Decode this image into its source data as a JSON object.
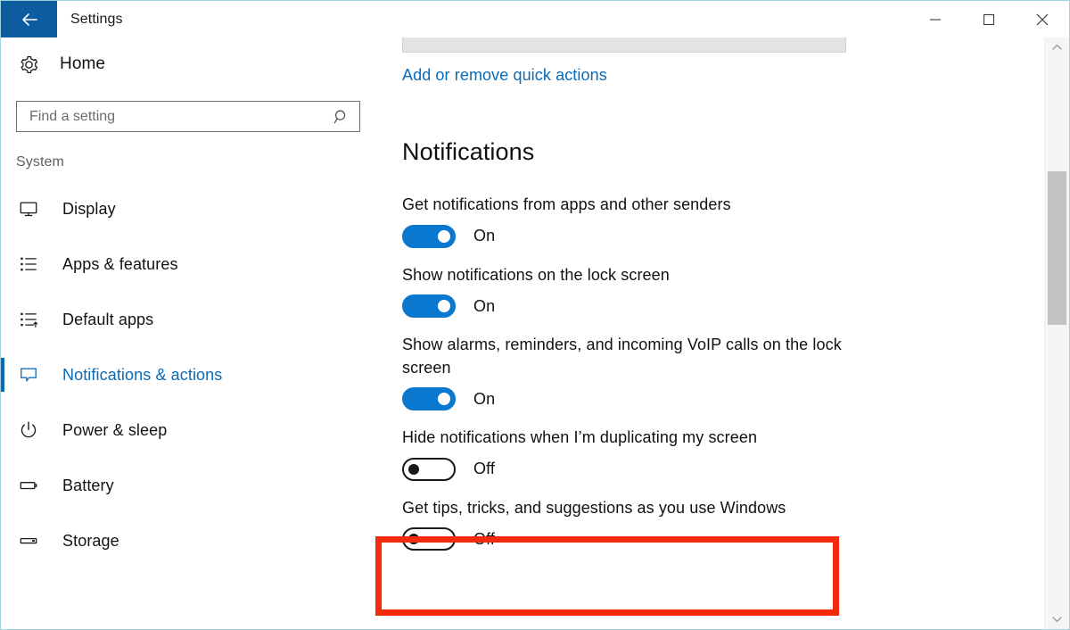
{
  "window": {
    "title": "Settings",
    "back_icon": "back-arrow-icon",
    "controls": [
      {
        "name": "minimize-button",
        "icon": "minimize-icon",
        "label": "Minimize"
      },
      {
        "name": "maximize-button",
        "icon": "maximize-icon",
        "label": "Maximize"
      },
      {
        "name": "close-button",
        "icon": "close-icon",
        "label": "Close"
      }
    ]
  },
  "sidebar": {
    "home": {
      "label": "Home",
      "icon": "gear-icon"
    },
    "search": {
      "placeholder": "Find a setting",
      "value": "",
      "icon": "search-icon"
    },
    "section_label": "System",
    "items": [
      {
        "label": "Display",
        "icon": "monitor-icon",
        "selected": false
      },
      {
        "label": "Apps & features",
        "icon": "app-list-icon",
        "selected": false
      },
      {
        "label": "Default apps",
        "icon": "default-apps-icon",
        "selected": false
      },
      {
        "label": "Notifications & actions",
        "icon": "notification-icon",
        "selected": true
      },
      {
        "label": "Power & sleep",
        "icon": "power-icon",
        "selected": false
      },
      {
        "label": "Battery",
        "icon": "battery-icon",
        "selected": false
      },
      {
        "label": "Storage",
        "icon": "storage-icon",
        "selected": false
      }
    ]
  },
  "content": {
    "quick_actions_link": "Add or remove quick actions",
    "heading": "Notifications",
    "settings": [
      {
        "label": "Get notifications from apps and other senders",
        "state": "On",
        "on": true,
        "wide": false
      },
      {
        "label": "Show notifications on the lock screen",
        "state": "On",
        "on": true,
        "wide": false
      },
      {
        "label": "Show alarms, reminders, and incoming VoIP calls on the lock screen",
        "state": "On",
        "on": true,
        "wide": true
      },
      {
        "label": "Hide notifications when I’m duplicating my screen",
        "state": "Off",
        "on": false,
        "wide": false
      },
      {
        "label": "Get tips, tricks, and suggestions as you use Windows",
        "state": "Off",
        "on": false,
        "wide": false
      }
    ]
  },
  "annotation": {
    "highlight_color": "#f32a0c",
    "highlights_setting_index": 4
  },
  "scrollbar": {
    "up_icon": "chevron-up-icon",
    "down_icon": "chevron-down-icon"
  },
  "colors": {
    "accent_blue": "#0b78d0",
    "link_blue": "#0a6bb8",
    "titlebar_back": "#0d5ca0",
    "highlight_red": "#f32a0c"
  }
}
